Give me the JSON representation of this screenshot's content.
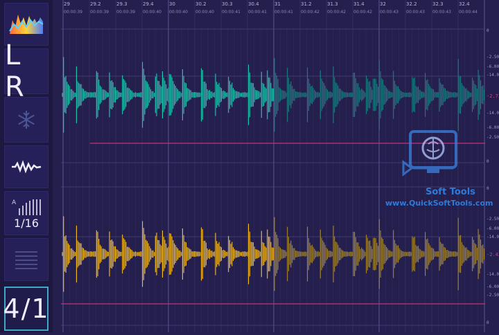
{
  "sidebar": {
    "logo_icon": "spectrum-logo-icon",
    "channel_label": "L R",
    "freeze_icon": "snowflake-icon",
    "wave_icon": "waveform-icon",
    "grid_icon": "grid-density-icon",
    "grid_label": "1/16",
    "lines_icon": "lines-icon",
    "meter_label": "4/1"
  },
  "timeline": {
    "ticks": [
      {
        "bar": "29",
        "time": "00:00:39"
      },
      {
        "bar": "29.2",
        "time": "00:00:39"
      },
      {
        "bar": "29.3",
        "time": "00:00:39"
      },
      {
        "bar": "29.4",
        "time": "00:00:40"
      },
      {
        "bar": "30",
        "time": "00:00:40"
      },
      {
        "bar": "30.2",
        "time": "00:00:40"
      },
      {
        "bar": "30.3",
        "time": "00:00:41"
      },
      {
        "bar": "30.4",
        "time": "00:00:41"
      },
      {
        "bar": "31",
        "time": "00:00:41"
      },
      {
        "bar": "31.2",
        "time": "00:00:42"
      },
      {
        "bar": "31.3",
        "time": "00:00:42"
      },
      {
        "bar": "31.4",
        "time": "00:00:42"
      },
      {
        "bar": "32",
        "time": "00:00:43"
      },
      {
        "bar": "32.2",
        "time": "00:00:43"
      },
      {
        "bar": "32.3",
        "time": "00:00:43"
      },
      {
        "bar": "32.4",
        "time": "00:00:44"
      }
    ]
  },
  "db_scale": {
    "top": [
      "0",
      "-2.50",
      "-6.00",
      "-14.0",
      "-14.0",
      "-6.00",
      "-2.50",
      "0"
    ],
    "top_marker": "-2.73",
    "bottom": [
      "0",
      "-2.50",
      "-6.00",
      "-14.0",
      "-14.0",
      "-6.00",
      "-2.50",
      "0"
    ],
    "bottom_marker": "-2.43"
  },
  "colors": {
    "left_channel": "#1fcdb5",
    "right_channel": "#ffc21a",
    "threshold_line": "#c6327c",
    "background": "#241f4c"
  },
  "watermark": {
    "icon": "brain-monitor-icon",
    "name": "Soft Tools",
    "url": "www.QuickSoftTools.com"
  }
}
